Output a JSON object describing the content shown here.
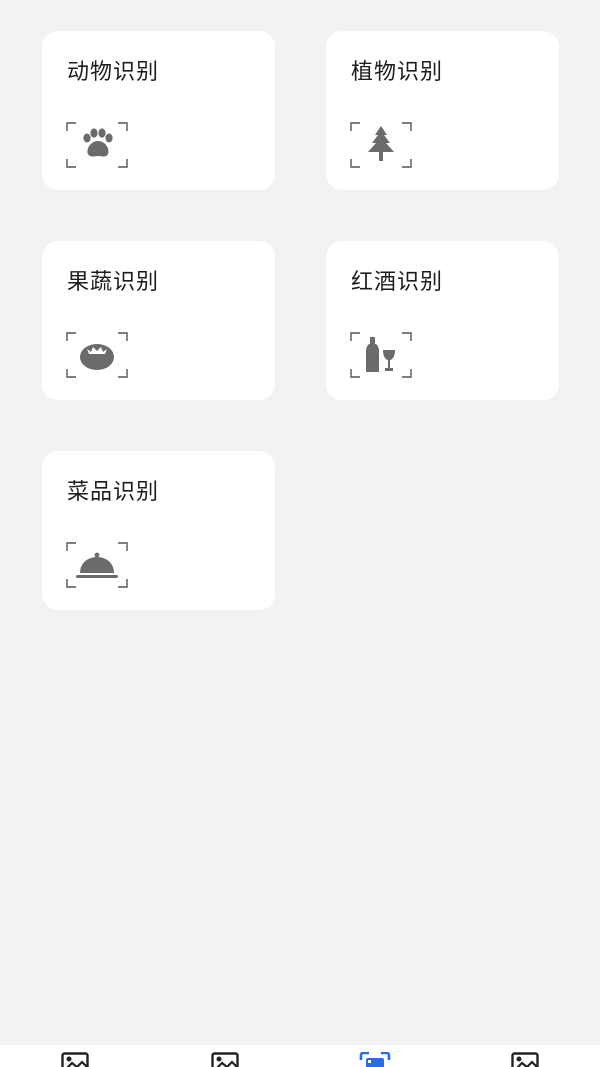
{
  "cards": [
    {
      "label": "动物识别",
      "icon": "paw-icon"
    },
    {
      "label": "植物识别",
      "icon": "tree-icon"
    },
    {
      "label": "果蔬识别",
      "icon": "tomato-icon"
    },
    {
      "label": "红酒识别",
      "icon": "wine-icon"
    },
    {
      "label": "菜品识别",
      "icon": "cloche-icon"
    }
  ],
  "tabbar": {
    "tabs": [
      {
        "icon": "image-icon",
        "active": false
      },
      {
        "icon": "image-icon",
        "active": false
      },
      {
        "icon": "scan-icon",
        "active": true
      },
      {
        "icon": "image-icon",
        "active": false
      }
    ]
  },
  "colors": {
    "background": "#f1f2f4",
    "card": "#ffffff",
    "text": "#1d1d1f",
    "icon": "#6b6b6b",
    "frame": "#555555",
    "accent": "#2a6be8"
  }
}
